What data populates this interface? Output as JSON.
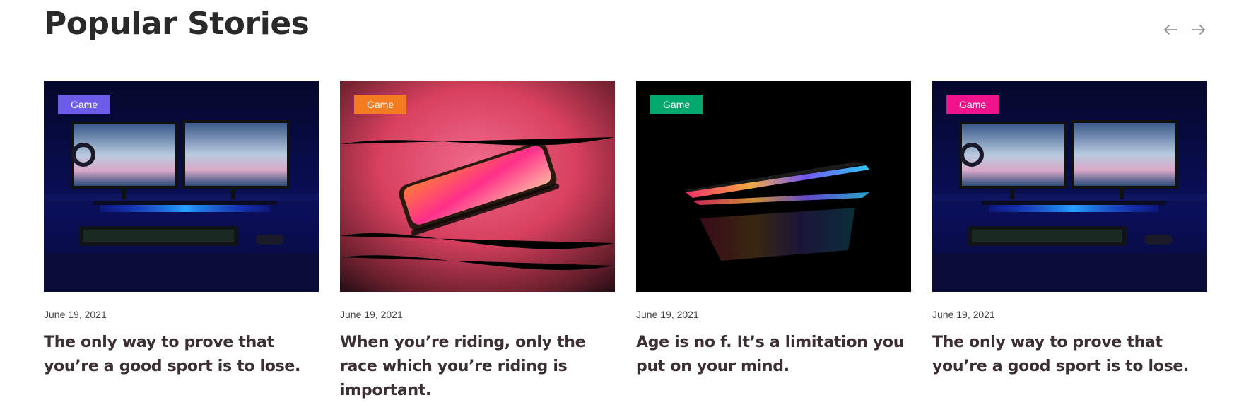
{
  "section": {
    "title": "Popular Stories",
    "nav": {
      "prev_icon": "arrow-left-icon",
      "next_icon": "arrow-right-icon"
    }
  },
  "cards": [
    {
      "tag": "Game",
      "tag_color": "#6c5ce7",
      "image": "dual-monitor-desk-setup",
      "date": "June 19, 2021",
      "title": "The only way to prove that you’re a good sport is to lose."
    },
    {
      "tag": "Game",
      "tag_color": "#f47c20",
      "image": "smartphone-on-table",
      "date": "June 19, 2021",
      "title": "When you’re riding, only the race which you’re riding is important."
    },
    {
      "tag": "Game",
      "tag_color": "#00a86b",
      "image": "laptop-glowing-in-dark",
      "date": "June 19, 2021",
      "title": "Age is no f. It’s a limitation you put on your mind."
    },
    {
      "tag": "Game",
      "tag_color": "#f0148c",
      "image": "dual-monitor-desk-setup",
      "date": "June 19, 2021",
      "title": "The only way to prove that you’re a good sport is to lose."
    }
  ]
}
